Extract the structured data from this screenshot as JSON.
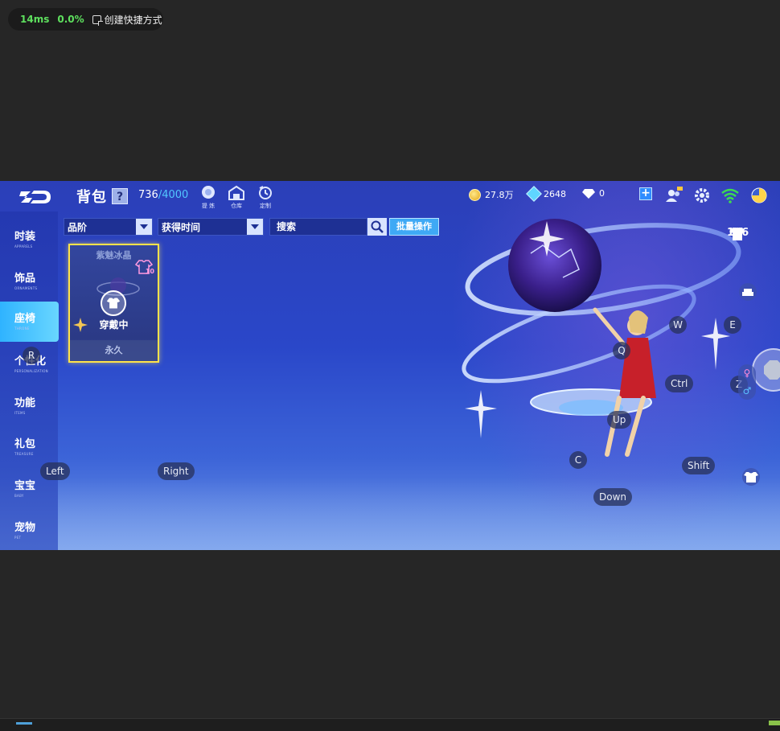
{
  "overlay": {
    "latency": "14ms",
    "loss": "0.0%",
    "shortcut_label": "创建快捷方式"
  },
  "topbar": {
    "title": "背包",
    "help": "?",
    "capacity_used": "736",
    "capacity_max": "/4000",
    "tools": [
      {
        "label": "提 炼",
        "icon": "refine-icon"
      },
      {
        "label": "仓库",
        "icon": "warehouse-icon"
      },
      {
        "label": "定制",
        "icon": "custom-icon"
      }
    ],
    "gold": "27.8万",
    "crystal": "2648",
    "diamond": "0",
    "add": "+"
  },
  "sidebar": {
    "items": [
      {
        "label": "时装",
        "sub": "APPARELS"
      },
      {
        "label": "饰品",
        "sub": "ORNAMENTS"
      },
      {
        "label": "座椅",
        "sub": "THRONE"
      },
      {
        "label": "个性化",
        "sub": "PERSONALIZATION"
      },
      {
        "label": "功能",
        "sub": "ITEMS"
      },
      {
        "label": "礼包",
        "sub": "TREASURE"
      },
      {
        "label": "宝宝",
        "sub": "BABY"
      },
      {
        "label": "宠物",
        "sub": "PET"
      }
    ],
    "active_index": 2
  },
  "filters": {
    "quality": "品阶",
    "time": "获得时间",
    "search_placeholder": "搜索",
    "batch": "批量操作"
  },
  "item": {
    "name": "紫魅冰晶",
    "badge": "10",
    "status": "穿戴中",
    "duration": "永久"
  },
  "keys": {
    "r": "R",
    "left": "Left",
    "right": "Right",
    "w": "W",
    "e": "E",
    "q": "Q",
    "ctrl": "Ctrl",
    "z": "Z",
    "up": "Up",
    "c": "C",
    "shift": "Shift",
    "down": "Down"
  },
  "right_panel": {
    "outfit_count": "126",
    "gender_female": "♀",
    "gender_male": "♂"
  },
  "colors": {
    "accent_blue": "#3fa9f5",
    "highlight_yellow": "#ffe34a",
    "ping_green": "#5ee05e",
    "capacity_max": "#52c8ff"
  }
}
